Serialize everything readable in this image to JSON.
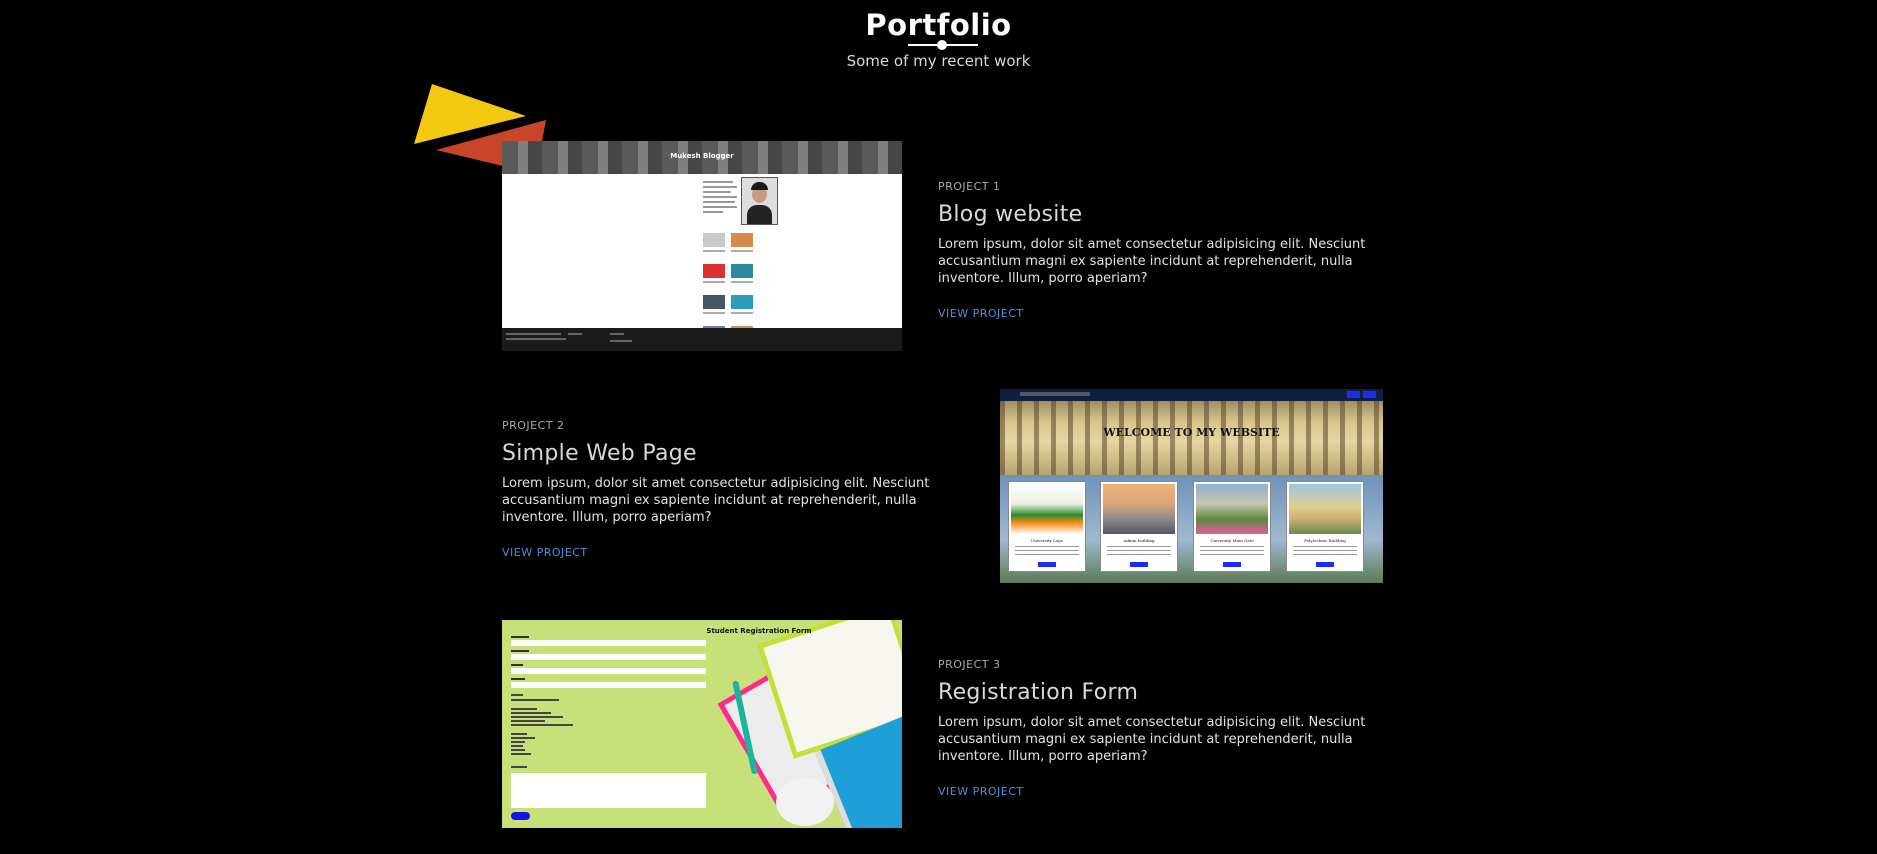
{
  "header": {
    "title": "Portfolio",
    "subtitle": "Some of my recent work"
  },
  "colors": {
    "background": "#000000",
    "link": "#4a90e2",
    "triangle_yellow": "#f2c811",
    "triangle_red": "#c9452a"
  },
  "projects": [
    {
      "label": "PROJECT 1",
      "title": "Blog website",
      "description": "Lorem ipsum, dolor sit amet consectetur adipisicing elit. Nesciunt accusantium magni ex sapiente incidunt at reprehenderit, nulla inventore. Illum, porro aperiam?",
      "link": "VIEW PROJECT",
      "thumbnail": {
        "header_title": "Mukesh Blogger"
      }
    },
    {
      "label": "PROJECT 2",
      "title": "Simple Web Page",
      "description": "Lorem ipsum, dolor sit amet consectetur adipisicing elit. Nesciunt accusantium magni ex sapiente incidunt at reprehenderit, nulla inventore. Illum, porro aperiam?",
      "link": "VIEW PROJECT",
      "thumbnail": {
        "heading": "WELCOME TO MY WEBSITE",
        "cards": [
          "University Logo",
          "Admin building",
          "University Main Gate",
          "Polytechnic Building"
        ]
      }
    },
    {
      "label": "PROJECT 3",
      "title": "Registration Form",
      "description": "Lorem ipsum, dolor sit amet consectetur adipisicing elit. Nesciunt accusantium magni ex sapiente incidunt at reprehenderit, nulla inventore. Illum, porro aperiam?",
      "link": "VIEW PROJECT",
      "thumbnail": {
        "form_title": "Student Registration Form"
      }
    }
  ]
}
